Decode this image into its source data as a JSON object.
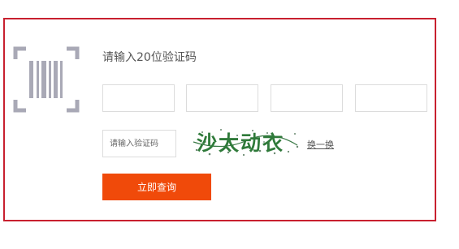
{
  "form": {
    "prompt": "请输入20位验证码",
    "code_boxes": [
      "",
      "",
      "",
      ""
    ],
    "captcha_placeholder": "请输入验证码",
    "captcha_text": "沙太动衣",
    "refresh_label": "换一换",
    "submit_label": "立即查询"
  },
  "icons": {
    "barcode": "barcode-scan-icon"
  },
  "colors": {
    "border": "#c8202f",
    "button": "#f04a0a",
    "captcha_text": "#2f7a3a",
    "icon": "#a9a9b6"
  }
}
